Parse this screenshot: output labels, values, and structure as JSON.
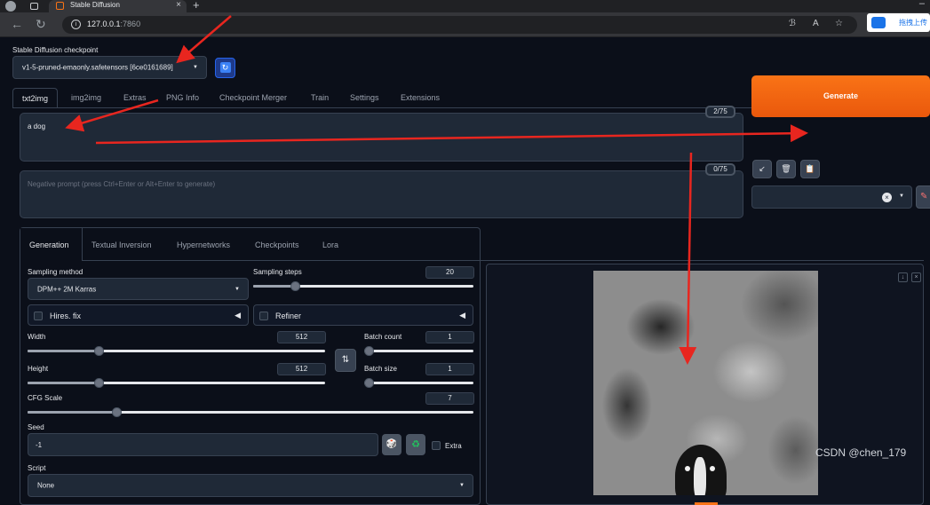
{
  "browser": {
    "tab_title": "Stable Diffusion",
    "new_tab": "+",
    "url_host": "127.0.0.1",
    "url_port": ":7860",
    "extension_label": "拖拽上传"
  },
  "checkpoint": {
    "label": "Stable Diffusion checkpoint",
    "value": "v1-5-pruned-emaonly.safetensors [6ce0161689]"
  },
  "main_tabs": [
    "txt2img",
    "img2img",
    "Extras",
    "PNG Info",
    "Checkpoint Merger",
    "Train",
    "Settings",
    "Extensions"
  ],
  "prompt": {
    "value": "a dog",
    "counter": "2/75"
  },
  "negative_prompt": {
    "placeholder": "Negative prompt (press Ctrl+Enter or Alt+Enter to generate)",
    "counter": "0/75"
  },
  "generate_label": "Generate",
  "sub_tabs": [
    "Generation",
    "Textual Inversion",
    "Hypernetworks",
    "Checkpoints",
    "Lora"
  ],
  "generation": {
    "sampling_method_label": "Sampling method",
    "sampling_method": "DPM++ 2M Karras",
    "sampling_steps_label": "Sampling steps",
    "sampling_steps": "20",
    "hires_label": "Hires. fix",
    "refiner_label": "Refiner",
    "width_label": "Width",
    "width": "512",
    "height_label": "Height",
    "height": "512",
    "batch_count_label": "Batch count",
    "batch_count": "1",
    "batch_size_label": "Batch size",
    "batch_size": "1",
    "cfg_label": "CFG Scale",
    "cfg": "7",
    "seed_label": "Seed",
    "seed": "-1",
    "extra_label": "Extra",
    "script_label": "Script",
    "script": "None"
  },
  "slider_levels": {
    "sampling_steps": 0.19,
    "width": 0.24,
    "height": 0.24,
    "batch_count": 0.0,
    "batch_size": 0.0,
    "cfg": 0.2
  },
  "watermark": "CSDN @chen_179",
  "colors": {
    "accent": "#f97316",
    "background": "#0b0f19",
    "arrow": "#e8261f"
  }
}
